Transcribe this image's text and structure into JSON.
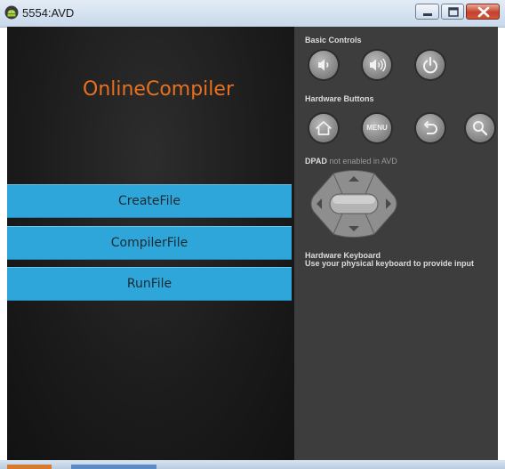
{
  "window": {
    "title": "5554:AVD",
    "controls": [
      "minimize",
      "maximize",
      "close"
    ]
  },
  "app": {
    "title": "OnlineCompiler",
    "title_color": "#e8701e",
    "buttons": [
      "CreateFile",
      "CompilerFile",
      "RunFile"
    ],
    "button_color": "#2fa6d9"
  },
  "panel": {
    "basic_controls": "Basic Controls",
    "basic_buttons": [
      "volume-down-icon",
      "volume-up-icon",
      "power-icon"
    ],
    "hardware_buttons": "Hardware Buttons",
    "hw_buttons": [
      "home-icon",
      "menu",
      "back-icon",
      "search-icon"
    ],
    "menu_label": "MENU",
    "dpad_label": "DPAD",
    "dpad_note": "not enabled in AVD",
    "keyboard_title": "Hardware Keyboard",
    "keyboard_note": "Use your physical keyboard to provide input"
  }
}
